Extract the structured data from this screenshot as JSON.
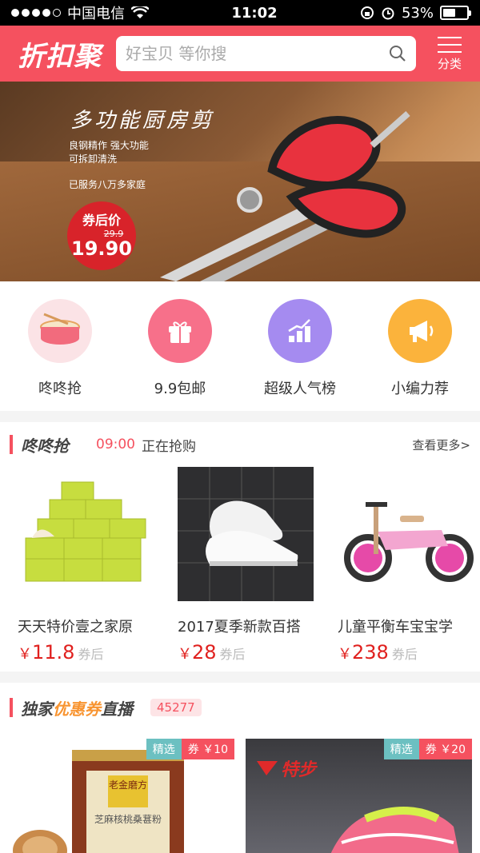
{
  "status": {
    "carrier": "中国电信",
    "time": "11:02",
    "battery": "53%",
    "battery_level": 0.53
  },
  "header": {
    "logo": "折扣聚",
    "search_placeholder": "好宝贝 等你搜",
    "category_label": "分类"
  },
  "banner": {
    "title": "多功能厨房剪",
    "line1": "良钢精作  强大功能",
    "line2": "可拆卸清洗",
    "served": "已服务八万多家庭",
    "badge_label": "券后价",
    "old_price": "29.9",
    "new_price": "19.90"
  },
  "quick_links": [
    {
      "label": "咚咚抢",
      "icon": "drum-icon",
      "color": "#fbe3e6"
    },
    {
      "label": "9.9包邮",
      "icon": "gift-icon",
      "color": "#f7708a"
    },
    {
      "label": "超级人气榜",
      "icon": "chart-icon",
      "color": "#a58bf0"
    },
    {
      "label": "小编力荐",
      "icon": "megaphone-icon",
      "color": "#fbb33c"
    }
  ],
  "flash": {
    "title": "咚咚抢",
    "time": "09:00",
    "status": "正在抢购",
    "more": "查看更多>",
    "products": [
      {
        "name": "天天特价壹之家原",
        "yen": "￥",
        "price": "11.8",
        "after": "券后"
      },
      {
        "name": "2017夏季新款百搭",
        "yen": "￥",
        "price": "28",
        "after": "券后"
      },
      {
        "name": "儿童平衡车宝宝学",
        "yen": "￥",
        "price": "238",
        "after": "券后"
      }
    ]
  },
  "coupon": {
    "title_a": "独家",
    "title_b": "优惠券",
    "title_c": "直播",
    "count": "45277",
    "cards": [
      {
        "tag": "精选",
        "coupon": "券 ￥10",
        "brand": "老金磨方",
        "product": "芝麻核桃桑葚粉"
      },
      {
        "tag": "精选",
        "coupon": "券 ￥20",
        "brand": "特步"
      }
    ]
  }
}
